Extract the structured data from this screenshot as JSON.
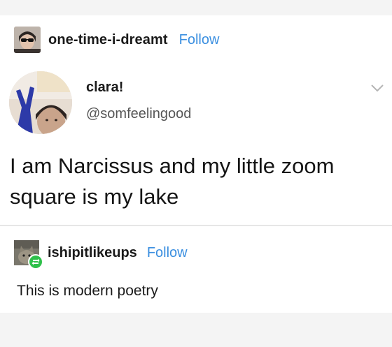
{
  "post": {
    "username": "one-time-i-dreamt",
    "follow_label": "Follow",
    "avatar_icon": "user-avatar-sunglasses"
  },
  "tweet": {
    "display_name": "clara!",
    "handle": "@somfeelingood",
    "text": "I am Narcissus and my little zoom square is my lake",
    "avatar_icon": "user-avatar-peace-sign",
    "menu_icon": "chevron-down-icon"
  },
  "reblog": {
    "username": "ishipitlikeups",
    "follow_label": "Follow",
    "comment": "This is modern poetry",
    "avatar_icon": "user-avatar-cat",
    "badge_icon": "reblog-icon"
  },
  "colors": {
    "follow": "#3b8fe0",
    "reblog_badge": "#2ec04a",
    "divider": "#e6e6e6",
    "band": "#f4f4f4"
  }
}
